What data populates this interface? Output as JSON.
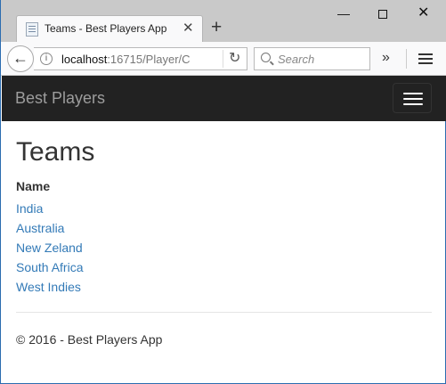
{
  "browser": {
    "tab_title": "Teams - Best Players App",
    "tab_close": "✕",
    "new_tab": "+",
    "url_host": "localhost",
    "url_path": ":16715/Player/C",
    "search_placeholder": "Search",
    "overflow": "»",
    "window_controls": {
      "minimize": "—",
      "close": "✕"
    }
  },
  "navbar": {
    "brand": "Best Players"
  },
  "main": {
    "title": "Teams",
    "column_header": "Name",
    "teams": [
      "India",
      "Australia",
      "New Zeland",
      "South Africa",
      "West Indies"
    ]
  },
  "footer": {
    "text": "© 2016 - Best Players App"
  },
  "colors": {
    "navbar_bg": "#222222",
    "brand": "#9d9d9d",
    "link": "#337ab7"
  }
}
